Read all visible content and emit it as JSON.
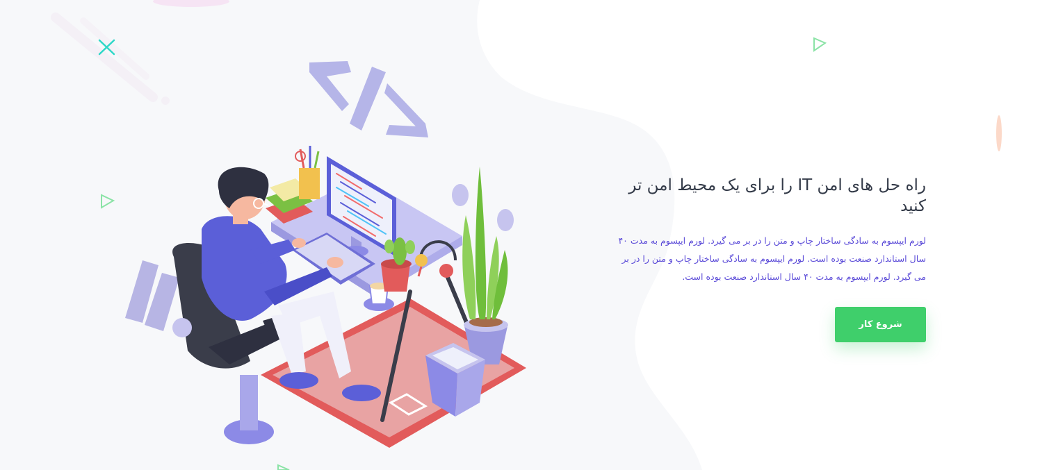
{
  "hero": {
    "title": "راه حل های امن IT را برای یک محیط امن تر کنید",
    "description": "لورم ایپسوم به سادگی ساختار چاپ و متن را در بر می گیرد. لورم ایپسوم به مدت ۴۰ سال استاندارد صنعت بوده است. لورم ایپسوم به سادگی ساختار چاپ و متن را در بر می گیرد. لورم ایپسوم به مدت ۴۰ سال استاندارد صنعت بوده است.",
    "cta_label": "شروع کار",
    "illustration_icon": "developer-at-desk-illustration",
    "code_symbol_icon": "code-brackets-icon"
  },
  "colors": {
    "accent_green": "#3fcf6b",
    "text_dark": "#333a48",
    "text_purple": "#5b4bd8",
    "illustration_purple": "#8c8ae6",
    "rug_red": "#e25b5b",
    "background_blob": "#f7f8fa"
  }
}
